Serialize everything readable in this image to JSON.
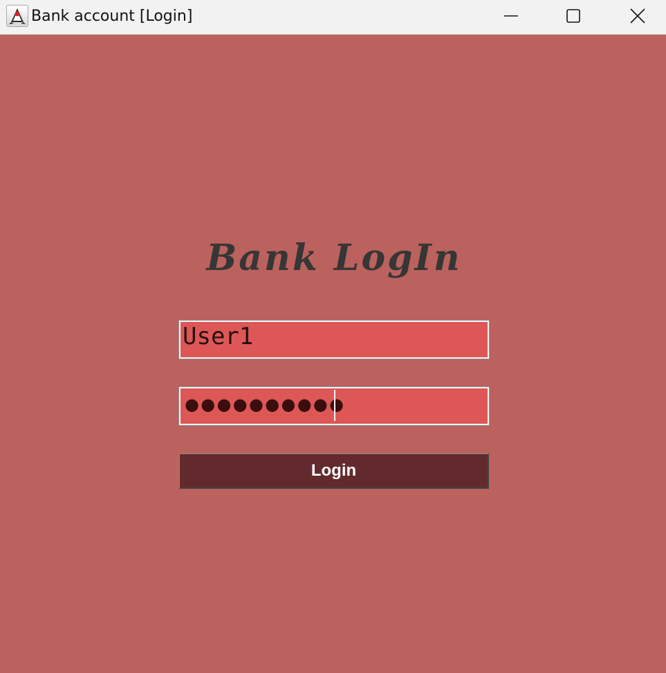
{
  "window": {
    "title": "Bank account [Login]",
    "icon": "java-duke-icon",
    "controls": [
      "minimize-icon",
      "maximize-icon",
      "close-icon"
    ]
  },
  "login": {
    "heading": "Bank LogIn",
    "username_value": "User1",
    "password_mask": "●●●●●●●●●●",
    "button_label": "Login"
  },
  "colors": {
    "background": "#bb615e",
    "field_background": "#dd5757",
    "button_background": "#632a2d",
    "heading_text": "#363636"
  }
}
